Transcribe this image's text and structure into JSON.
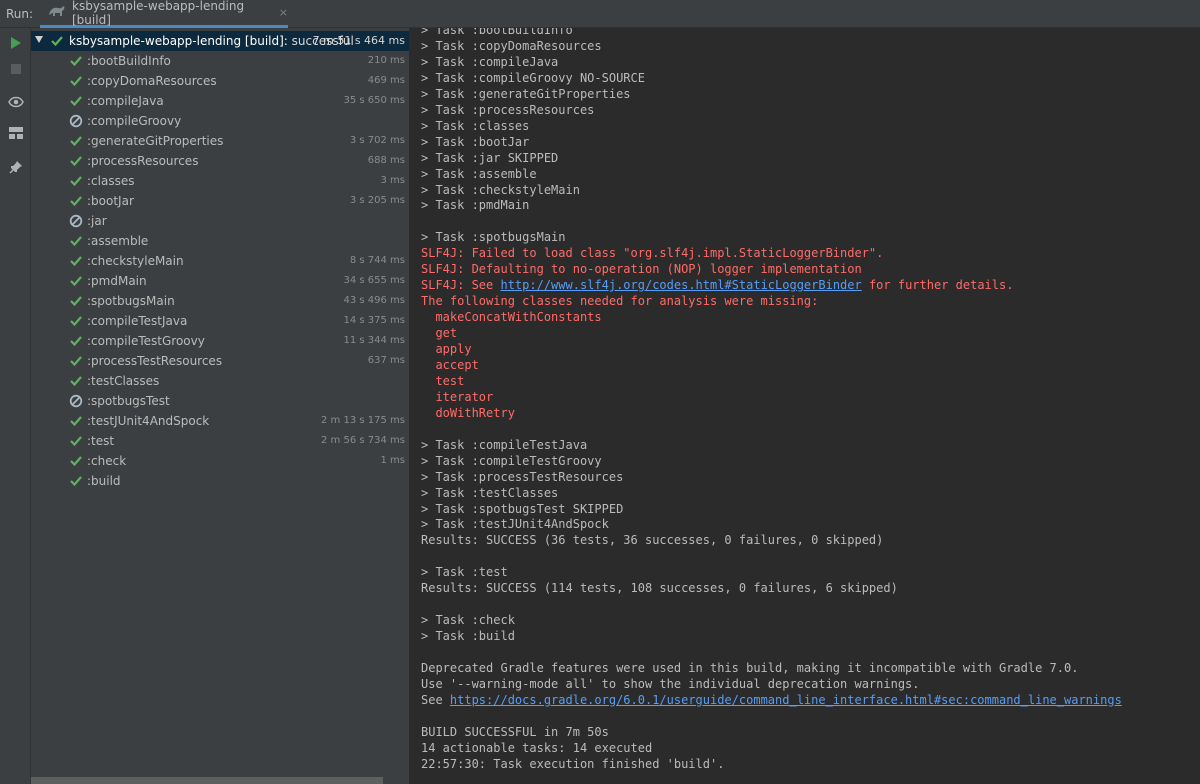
{
  "header": {
    "run_label": "Run:",
    "tab_title": "ksbysample-webapp-lending [build]",
    "close_glyph": "×"
  },
  "toolbar": {
    "icons": [
      "rerun-icon",
      "stop-icon",
      "eye-icon",
      "layout-icon",
      "pin-icon"
    ]
  },
  "colors": {
    "success": "#5fb25f",
    "skipped": "#a9b7c6",
    "error": "#ff6b68",
    "link": "#589df6",
    "accent": "#4a88c7"
  },
  "tree": {
    "root": {
      "name": "ksbysample-webapp-lending [build]:",
      "status": "successful",
      "duration": "7 m 51 s 464 ms"
    },
    "tasks": [
      {
        "name": ":bootBuildInfo",
        "duration": "210 ms",
        "state": "success"
      },
      {
        "name": ":copyDomaResources",
        "duration": "469 ms",
        "state": "success"
      },
      {
        "name": ":compileJava",
        "duration": "35 s 650 ms",
        "state": "success"
      },
      {
        "name": ":compileGroovy",
        "duration": "",
        "state": "skipped"
      },
      {
        "name": ":generateGitProperties",
        "duration": "3 s 702 ms",
        "state": "success"
      },
      {
        "name": ":processResources",
        "duration": "688 ms",
        "state": "success"
      },
      {
        "name": ":classes",
        "duration": "3 ms",
        "state": "success"
      },
      {
        "name": ":bootJar",
        "duration": "3 s 205 ms",
        "state": "success"
      },
      {
        "name": ":jar",
        "duration": "",
        "state": "skipped"
      },
      {
        "name": ":assemble",
        "duration": "",
        "state": "success"
      },
      {
        "name": ":checkstyleMain",
        "duration": "8 s 744 ms",
        "state": "success"
      },
      {
        "name": ":pmdMain",
        "duration": "34 s 655 ms",
        "state": "success"
      },
      {
        "name": ":spotbugsMain",
        "duration": "43 s 496 ms",
        "state": "success"
      },
      {
        "name": ":compileTestJava",
        "duration": "14 s 375 ms",
        "state": "success"
      },
      {
        "name": ":compileTestGroovy",
        "duration": "11 s 344 ms",
        "state": "success"
      },
      {
        "name": ":processTestResources",
        "duration": "637 ms",
        "state": "success"
      },
      {
        "name": ":testClasses",
        "duration": "",
        "state": "success"
      },
      {
        "name": ":spotbugsTest",
        "duration": "",
        "state": "skipped"
      },
      {
        "name": ":testJUnit4AndSpock",
        "duration": "2 m 13 s 175 ms",
        "state": "success"
      },
      {
        "name": ":test",
        "duration": "2 m 56 s 734 ms",
        "state": "success"
      },
      {
        "name": ":check",
        "duration": "1 ms",
        "state": "success"
      },
      {
        "name": ":build",
        "duration": "",
        "state": "success"
      }
    ]
  },
  "console": {
    "lines": [
      {
        "text": "> Task :bootBuildInfo",
        "kind": "normal"
      },
      {
        "text": "> Task :copyDomaResources",
        "kind": "normal"
      },
      {
        "text": "> Task :compileJava",
        "kind": "normal"
      },
      {
        "text": "> Task :compileGroovy NO-SOURCE",
        "kind": "normal"
      },
      {
        "text": "> Task :generateGitProperties",
        "kind": "normal"
      },
      {
        "text": "> Task :processResources",
        "kind": "normal"
      },
      {
        "text": "> Task :classes",
        "kind": "normal"
      },
      {
        "text": "> Task :bootJar",
        "kind": "normal"
      },
      {
        "text": "> Task :jar SKIPPED",
        "kind": "normal"
      },
      {
        "text": "> Task :assemble",
        "kind": "normal"
      },
      {
        "text": "> Task :checkstyleMain",
        "kind": "normal"
      },
      {
        "text": "> Task :pmdMain",
        "kind": "normal"
      },
      {
        "text": "",
        "kind": "normal"
      },
      {
        "text": "> Task :spotbugsMain",
        "kind": "normal"
      },
      {
        "text": "SLF4J: Failed to load class \"org.slf4j.impl.StaticLoggerBinder\".",
        "kind": "err"
      },
      {
        "text": "SLF4J: Defaulting to no-operation (NOP) logger implementation",
        "kind": "err"
      },
      {
        "pre": "SLF4J: See ",
        "link": "http://www.slf4j.org/codes.html#StaticLoggerBinder",
        "post": " for further details.",
        "kind": "err"
      },
      {
        "text": "The following classes needed for analysis were missing:",
        "kind": "err"
      },
      {
        "text": "  makeConcatWithConstants",
        "kind": "err"
      },
      {
        "text": "  get",
        "kind": "err"
      },
      {
        "text": "  apply",
        "kind": "err"
      },
      {
        "text": "  accept",
        "kind": "err"
      },
      {
        "text": "  test",
        "kind": "err"
      },
      {
        "text": "  iterator",
        "kind": "err"
      },
      {
        "text": "  doWithRetry",
        "kind": "err"
      },
      {
        "text": "",
        "kind": "normal"
      },
      {
        "text": "> Task :compileTestJava",
        "kind": "normal"
      },
      {
        "text": "> Task :compileTestGroovy",
        "kind": "normal"
      },
      {
        "text": "> Task :processTestResources",
        "kind": "normal"
      },
      {
        "text": "> Task :testClasses",
        "kind": "normal"
      },
      {
        "text": "> Task :spotbugsTest SKIPPED",
        "kind": "normal"
      },
      {
        "text": "> Task :testJUnit4AndSpock",
        "kind": "normal"
      },
      {
        "text": "Results: SUCCESS (36 tests, 36 successes, 0 failures, 0 skipped)",
        "kind": "normal"
      },
      {
        "text": "",
        "kind": "normal"
      },
      {
        "text": "> Task :test",
        "kind": "normal"
      },
      {
        "text": "Results: SUCCESS (114 tests, 108 successes, 0 failures, 6 skipped)",
        "kind": "normal"
      },
      {
        "text": "",
        "kind": "normal"
      },
      {
        "text": "> Task :check",
        "kind": "normal"
      },
      {
        "text": "> Task :build",
        "kind": "normal"
      },
      {
        "text": "",
        "kind": "normal"
      },
      {
        "text": "Deprecated Gradle features were used in this build, making it incompatible with Gradle 7.0.",
        "kind": "normal"
      },
      {
        "text": "Use '--warning-mode all' to show the individual deprecation warnings.",
        "kind": "normal"
      },
      {
        "pre": "See ",
        "link": "https://docs.gradle.org/6.0.1/userguide/command_line_interface.html#sec:command_line_warnings",
        "post": "",
        "kind": "normal"
      },
      {
        "text": "",
        "kind": "normal"
      },
      {
        "text": "BUILD SUCCESSFUL in 7m 50s",
        "kind": "normal"
      },
      {
        "text": "14 actionable tasks: 14 executed",
        "kind": "normal"
      },
      {
        "text": "22:57:30: Task execution finished 'build'.",
        "kind": "normal"
      }
    ]
  }
}
